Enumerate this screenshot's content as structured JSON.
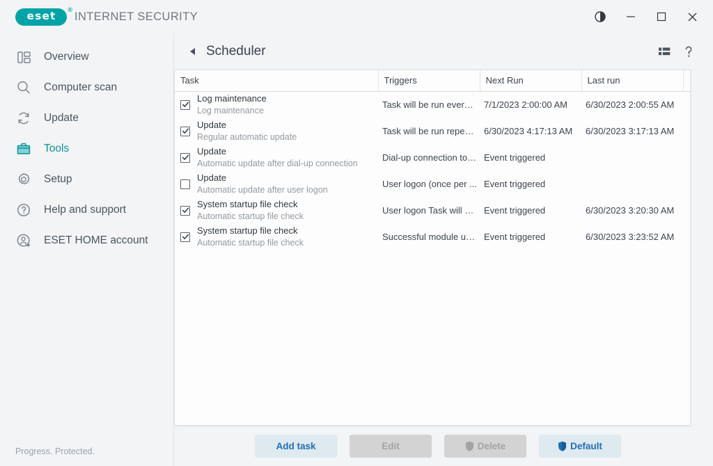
{
  "window": {
    "brand_logo_text": "eset",
    "brand_registered": "®",
    "product_name": "INTERNET SECURITY",
    "controls": {
      "theme_toggle": "contrast-toggle-icon",
      "minimize": "minimize-icon",
      "maximize": "maximize-icon",
      "close": "close-icon"
    }
  },
  "sidebar": {
    "items": [
      {
        "label": "Overview",
        "icon": "overview-icon",
        "active": false
      },
      {
        "label": "Computer scan",
        "icon": "search-icon",
        "active": false
      },
      {
        "label": "Update",
        "icon": "refresh-icon",
        "active": false
      },
      {
        "label": "Tools",
        "icon": "briefcase-icon",
        "active": true
      },
      {
        "label": "Setup",
        "icon": "gear-icon",
        "active": false
      },
      {
        "label": "Help and support",
        "icon": "question-circle-icon",
        "active": false
      },
      {
        "label": "ESET HOME account",
        "icon": "user-circle-icon",
        "active": false
      }
    ],
    "status_text": "Progress. Protected.",
    "accent_color": "#0f9298"
  },
  "header": {
    "back_icon": "back-arrow-icon",
    "title": "Scheduler",
    "tools": [
      {
        "name": "list-view-icon",
        "label": ""
      },
      {
        "name": "help-icon",
        "label": "?"
      }
    ]
  },
  "table": {
    "columns": [
      "Task",
      "Triggers",
      "Next Run",
      "Last run",
      ""
    ],
    "rows": [
      {
        "checked": true,
        "name": "Log maintenance",
        "sub": "Log maintenance",
        "triggers": "Task will be run every ...",
        "next_run": "7/1/2023 2:00:00 AM",
        "last_run": "6/30/2023 2:00:55 AM"
      },
      {
        "checked": true,
        "name": "Update",
        "sub": "Regular automatic update",
        "triggers": "Task will be run repeat...",
        "next_run": "6/30/2023 4:17:13 AM",
        "last_run": "6/30/2023 3:17:13 AM"
      },
      {
        "checked": true,
        "name": "Update",
        "sub": "Automatic update after dial-up connection",
        "triggers": "Dial-up connection to ...",
        "next_run": "Event triggered",
        "last_run": ""
      },
      {
        "checked": false,
        "name": "Update",
        "sub": "Automatic update after user logon",
        "triggers": "User logon (once per ...",
        "next_run": "Event triggered",
        "last_run": ""
      },
      {
        "checked": true,
        "name": "System startup file check",
        "sub": "Automatic startup file check",
        "triggers": "User logon Task will n...",
        "next_run": "Event triggered",
        "last_run": "6/30/2023 3:20:30 AM"
      },
      {
        "checked": true,
        "name": "System startup file check",
        "sub": "Automatic startup file check",
        "triggers": "Successful module up...",
        "next_run": "Event triggered",
        "last_run": "6/30/2023 3:23:52 AM"
      }
    ]
  },
  "footer": {
    "buttons": [
      {
        "label": "Add task",
        "style": "primary",
        "shield": false,
        "disabled": false
      },
      {
        "label": "Edit",
        "style": "disabled",
        "shield": false,
        "disabled": true
      },
      {
        "label": "Delete",
        "style": "disabled",
        "shield": true,
        "disabled": true
      },
      {
        "label": "Default",
        "style": "primary",
        "shield": true,
        "disabled": false
      }
    ]
  },
  "colors": {
    "brand_teal": "#00a4a6",
    "accent_blue": "#1f6fb5",
    "app_bg": "#f2f4f6",
    "panel_bg": "#fdfdfd"
  }
}
